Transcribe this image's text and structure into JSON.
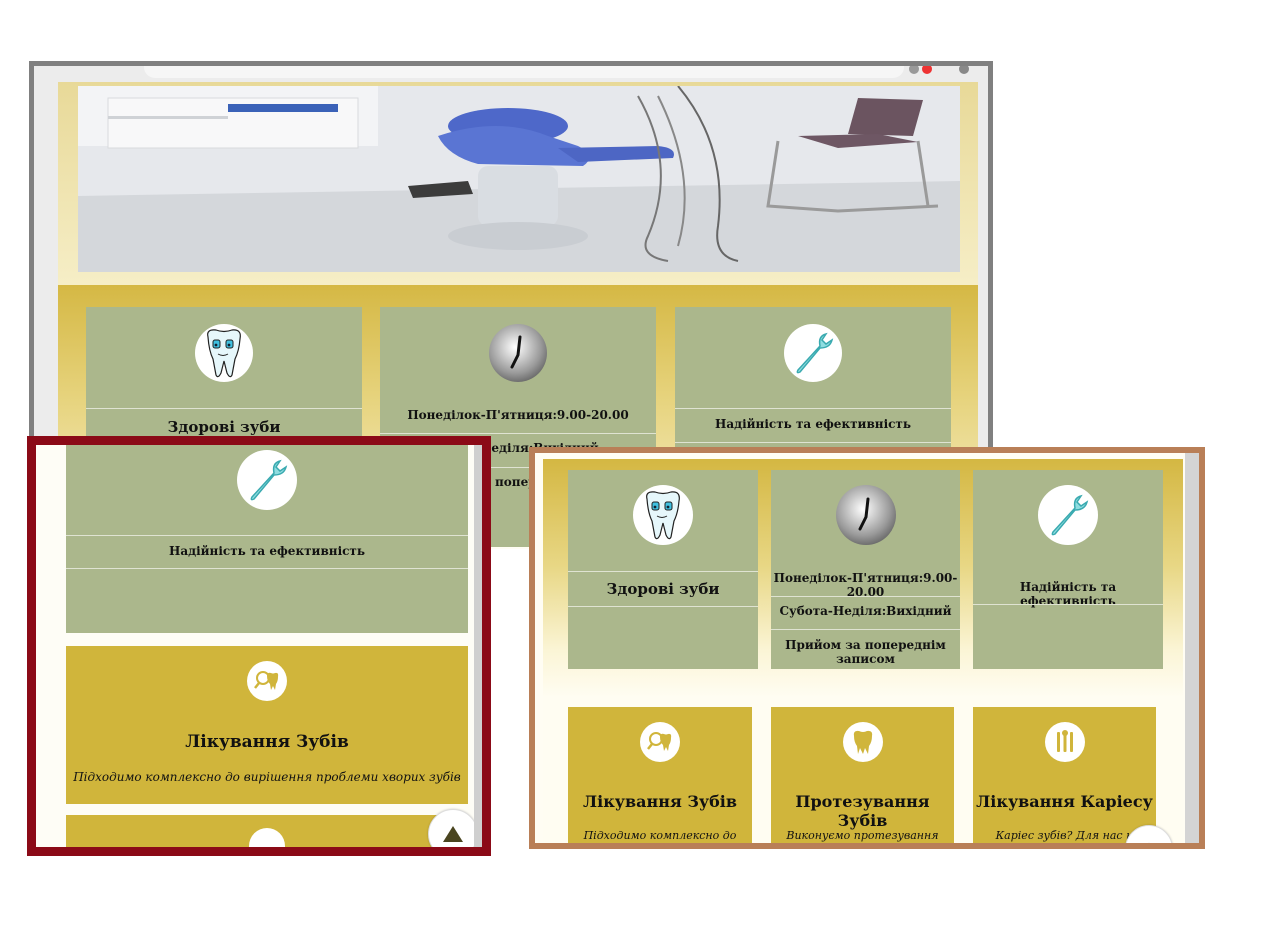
{
  "features": {
    "healthy": "Здорові зуби",
    "hours_weekdays": "Понеділок-П'ятниця:9.00-20.00",
    "hours_weekend": "Субота-Неділя:Вихідний",
    "hours_appointment": "Прийом за попереднім записом",
    "reliability": "Надійність та ефективність"
  },
  "back_window": {
    "partial_weekend": "Неділя:Вихідний",
    "partial_appointment": "попере"
  },
  "services": [
    {
      "title": "Лікування Зубів",
      "text": "Підходимо комплексно до вирішення проблеми хворих зубів",
      "icon": "tooth-magnifier-icon",
      "partial_text": "Підходимо комплексно до"
    },
    {
      "title": "Протезування Зубів",
      "text": "Виконуємо протезування зубів",
      "icon": "tooth-icon",
      "partial_text": "Виконуємо протезування зубів"
    },
    {
      "title": "Лікування Каріесу",
      "text": "Каріес зубів? Для нас н",
      "icon": "dental-tools-icon",
      "partial_text": "Каріес зубів? Для нас н"
    }
  ],
  "icons": {
    "feature_1": "tooth-cartoon-icon",
    "feature_2": "clock-icon",
    "feature_3": "wrench-icon",
    "scroll_top": "arrow-up-icon"
  },
  "colors": {
    "card_green": "#abb78c",
    "service_gold": "#d0b53b",
    "frame_red": "#8b0a17",
    "frame_brown": "#b97f57"
  }
}
